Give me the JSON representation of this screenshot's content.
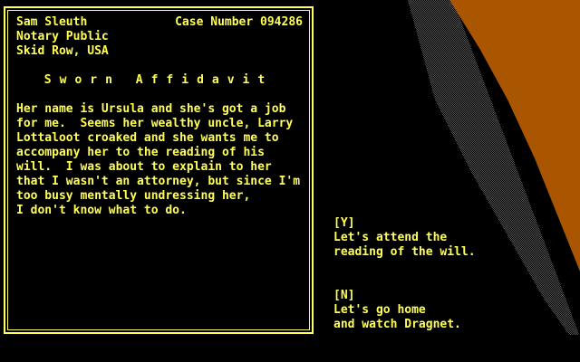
{
  "colors": {
    "text": "#ffff55",
    "background": "#000000",
    "backdrop_orange": "#aa5500",
    "backdrop_dither": "#555555"
  },
  "affidavit": {
    "header_left": [
      "Sam Sleuth",
      "Notary Public",
      "Skid Row, USA"
    ],
    "case_number": "Case Number 094286",
    "title": "Sworn Affidavit",
    "narrative": [
      "Her name is Ursula and she's got a job",
      "for me.  Seems her wealthy uncle, Larry",
      "Lottaloot croaked and she wants me to",
      "accompany her to the reading of his",
      "will.  I was about to explain to her",
      "that I wasn't an attorney, but since I'm",
      "too busy mentally undressing her,",
      "I don't know what to do."
    ]
  },
  "choices": {
    "yes": {
      "key": "[Y]",
      "lines": [
        "Let's attend the",
        "reading of the will."
      ]
    },
    "no": {
      "key": "[N]",
      "lines": [
        "Let's go home",
        "and watch Dragnet."
      ]
    }
  }
}
